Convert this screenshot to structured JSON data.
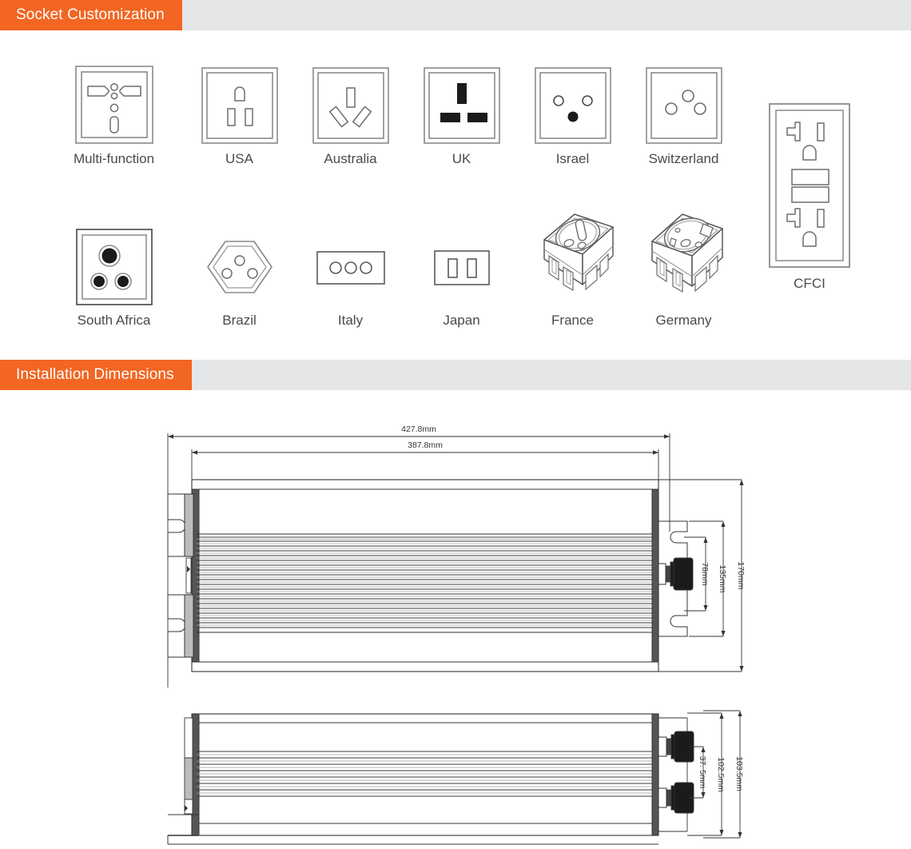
{
  "sections": [
    {
      "title": "Socket Customization"
    },
    {
      "title": "Installation Dimensions"
    }
  ],
  "sockets": {
    "row1": [
      {
        "label": "Multi-function",
        "icon": "socket-multifunction-icon"
      },
      {
        "label": "USA",
        "icon": "socket-usa-icon"
      },
      {
        "label": "Australia",
        "icon": "socket-australia-icon"
      },
      {
        "label": "UK",
        "icon": "socket-uk-icon"
      },
      {
        "label": "Israel",
        "icon": "socket-israel-icon"
      },
      {
        "label": "Switzerland",
        "icon": "socket-switzerland-icon"
      }
    ],
    "row2": [
      {
        "label": "South Africa",
        "icon": "socket-south-africa-icon"
      },
      {
        "label": "Brazil",
        "icon": "socket-brazil-icon"
      },
      {
        "label": "Italy",
        "icon": "socket-italy-icon"
      },
      {
        "label": "Japan",
        "icon": "socket-japan-icon"
      },
      {
        "label": "France",
        "icon": "socket-france-icon"
      },
      {
        "label": "Germany",
        "icon": "socket-germany-icon"
      }
    ],
    "cfci": {
      "label": "CFCI",
      "icon": "socket-cfci-icon"
    }
  },
  "dimensions": {
    "top_view": {
      "overall_length": "427.8mm",
      "body_length": "387.8mm",
      "overall_height": "170mm",
      "bracket_height": "135mm",
      "terminal_spacing": "78mm"
    },
    "side_view": {
      "overall_depth": "103.5mm",
      "body_depth": "102.5mm",
      "terminal_spacing": "37. 5mm"
    }
  },
  "colors": {
    "accent": "#f26522",
    "bar_background": "#e4e6e8",
    "label_text": "#4a4a4a",
    "line": "#3a3a3a"
  }
}
